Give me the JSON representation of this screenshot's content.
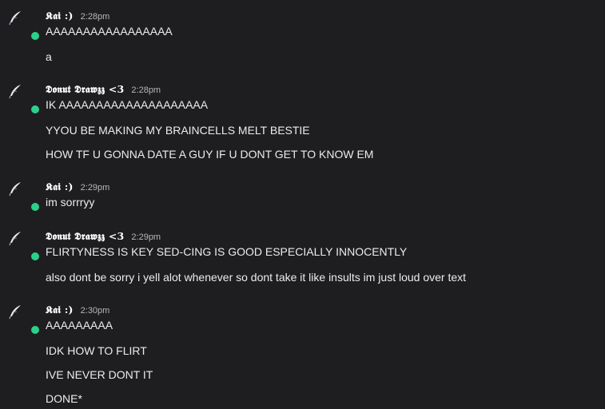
{
  "colors": {
    "background": "#1e1e20",
    "online_status": "#2bd18b",
    "username": "#ffffff",
    "timestamp": "#b7b7bb",
    "text": "#ececee"
  },
  "messages": [
    {
      "author": "𝕶𝖆𝖎 :)",
      "time": "2:28pm",
      "status": "online",
      "avatar_icon": "feather-avatar-icon",
      "lines": [
        "AAAAAAAAAAAAAAAAA",
        "a"
      ]
    },
    {
      "author": "𝕯𝖔𝖓𝖚𝖙 𝕯𝖗𝖆𝖜𝖟𝖟 <3",
      "time": "2:28pm",
      "status": "online",
      "avatar_icon": "feather-avatar-icon",
      "lines": [
        "IK AAAAAAAAAAAAAAAAAAAA",
        "YYOU BE MAKING MY BRAINCELLS MELT BESTIE",
        "HOW TF U GONNA DATE A GUY IF U DONT GET TO KNOW EM"
      ]
    },
    {
      "author": "𝕶𝖆𝖎 :)",
      "time": "2:29pm",
      "status": "online",
      "avatar_icon": "feather-avatar-icon",
      "lines": [
        "im sorrryy"
      ]
    },
    {
      "author": "𝕯𝖔𝖓𝖚𝖙 𝕯𝖗𝖆𝖜𝖟𝖟 <3",
      "time": "2:29pm",
      "status": "online",
      "avatar_icon": "feather-avatar-icon",
      "lines": [
        "FLIRTYNESS IS KEY SED-CING IS GOOD ESPECIALLY INNOCENTLY",
        "also dont be sorry i yell alot whenever so dont take it like insults im just loud over text"
      ]
    },
    {
      "author": "𝕶𝖆𝖎 :)",
      "time": "2:30pm",
      "status": "online",
      "avatar_icon": "feather-avatar-icon",
      "lines": [
        "AAAAAAAAA",
        "IDK HOW TO FLIRT",
        "IVE NEVER DONT IT",
        "DONE*"
      ]
    }
  ]
}
